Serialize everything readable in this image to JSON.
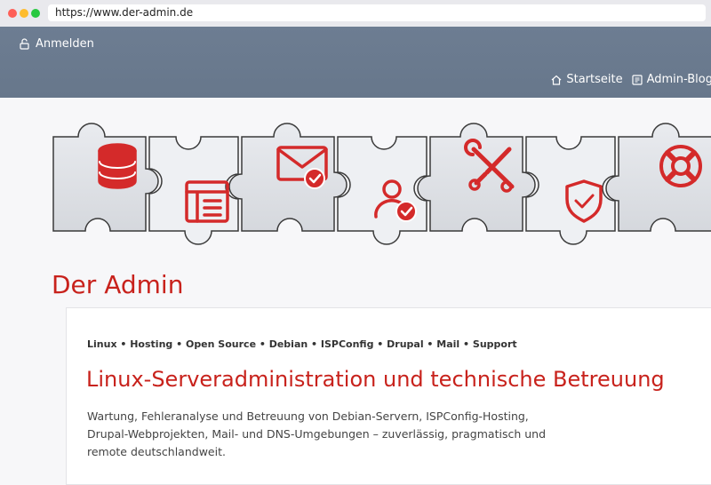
{
  "browser": {
    "url": "https://www.der-admin.de"
  },
  "header": {
    "login_label": "Anmelden",
    "nav": [
      {
        "label": "Startseite",
        "icon": "home-icon"
      },
      {
        "label": "Admin-Blog",
        "icon": "blog-icon"
      }
    ]
  },
  "banner": {
    "pieces": [
      "database-icon",
      "document-icon",
      "mail-check-icon",
      "user-check-icon",
      "tools-icon",
      "shield-check-icon",
      "lifebuoy-icon"
    ],
    "accent": "#d42a2a"
  },
  "site": {
    "title": "Der Admin"
  },
  "main": {
    "tags": "Linux • Hosting • Open Source • Debian • ISPConfig • Drupal • Mail • Support",
    "headline": "Linux-Serveradministration und technische Betreuung",
    "description": "Wartung, Fehleranalyse und Betreuung von Debian-Servern, ISPConfig-Hosting, Drupal-Webprojekten, Mail- und DNS-Umgebungen – zuverlässig, pragmatisch und remote deutschlandweit."
  }
}
